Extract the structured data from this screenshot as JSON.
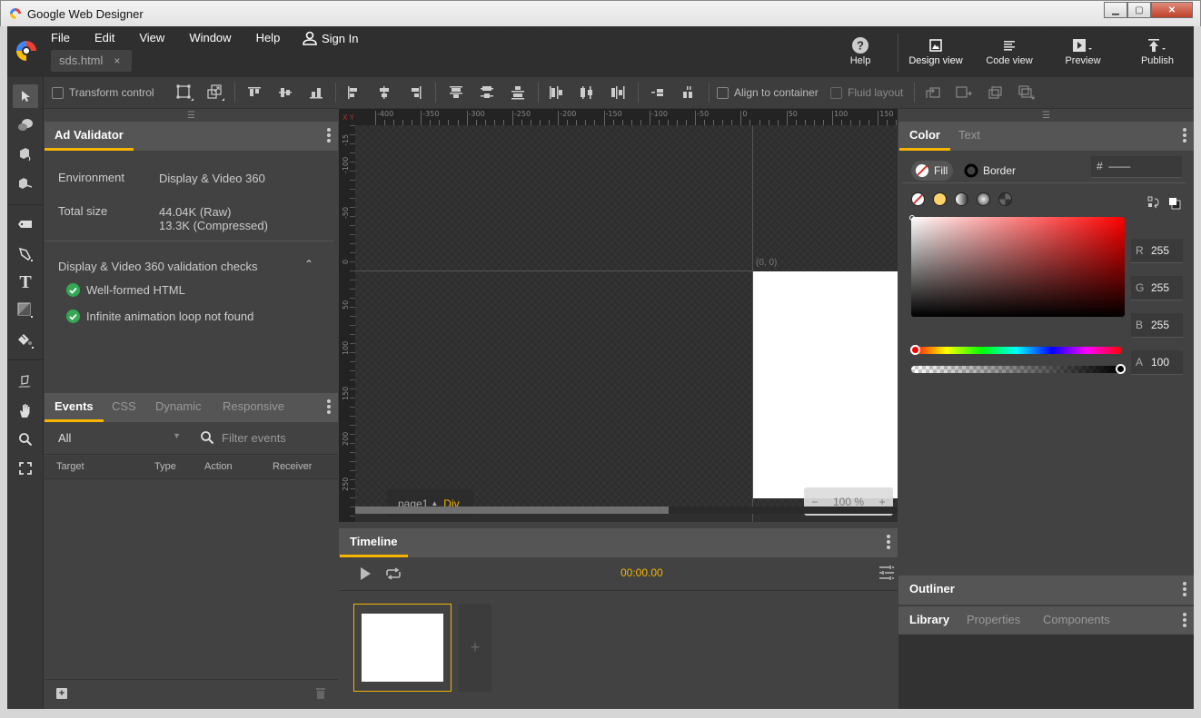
{
  "window": {
    "title": "Google Web Designer",
    "controls": {
      "minimize": "minimize",
      "maximize": "maximize",
      "close": "close"
    }
  },
  "menu": {
    "items": [
      "File",
      "Edit",
      "View",
      "Window",
      "Help"
    ],
    "sign_in": "Sign In"
  },
  "document_tab": {
    "name": "sds.html",
    "close": "×"
  },
  "top_buttons": {
    "help": "Help",
    "design_view": "Design view",
    "code_view": "Code view",
    "preview": "Preview",
    "publish": "Publish"
  },
  "toolbar": {
    "transform_control": "Transform control",
    "align_to_container": "Align to container",
    "fluid_layout": "Fluid layout"
  },
  "tools": [
    "selection",
    "3d-rotation",
    "3d-translation",
    "3d-object",
    "tag",
    "pen",
    "text",
    "shape",
    "fill",
    "paint-bucket",
    "hand",
    "zoom",
    "fullscreen"
  ],
  "ad_validator": {
    "tab": "Ad Validator",
    "environment_label": "Environment",
    "environment_value": "Display & Video 360",
    "total_size_label": "Total size",
    "total_size_raw": "44.04K (Raw)",
    "total_size_compressed": "13.3K (Compressed)",
    "checks_title": "Display & Video 360 validation checks",
    "checks": [
      "Well-formed HTML",
      "Infinite animation loop not found"
    ]
  },
  "events_panel": {
    "tabs": [
      "Events",
      "CSS",
      "Dynamic",
      "Responsive"
    ],
    "active_tab": "Events",
    "filter_select": "All",
    "filter_placeholder": "Filter events",
    "columns": [
      "Target",
      "Type",
      "Action",
      "Receiver"
    ]
  },
  "canvas": {
    "ruler_corner": "X Y",
    "h_ticks": [
      "-400",
      "-350",
      "-300",
      "-250",
      "-200",
      "-150",
      "-100",
      "-50",
      "0",
      "50",
      "100",
      "150"
    ],
    "v_ticks": [
      "-15",
      "-100",
      "-50",
      "0",
      "50",
      "100",
      "150",
      "200",
      "250"
    ],
    "origin_label": "(0, 0)",
    "page_name": "page1",
    "element_type": "Div",
    "zoom_minus": "−",
    "zoom_level": "100 %",
    "zoom_plus": "+"
  },
  "timeline": {
    "tab": "Timeline",
    "time": "00:00.00",
    "add_page": "+"
  },
  "color_panel": {
    "tabs": [
      "Color",
      "Text"
    ],
    "active_tab": "Color",
    "fill_label": "Fill",
    "border_label": "Border",
    "hex_prefix": "#",
    "hex_value": "——",
    "r_label": "R",
    "r_value": "255",
    "g_label": "G",
    "g_value": "255",
    "b_label": "B",
    "b_value": "255",
    "a_label": "A",
    "a_value": "100",
    "hue": "red",
    "accent": "#f5b400"
  },
  "outliner": {
    "title": "Outliner"
  },
  "library_panel": {
    "tabs": [
      "Library",
      "Properties",
      "Components"
    ],
    "active_tab": "Library"
  }
}
